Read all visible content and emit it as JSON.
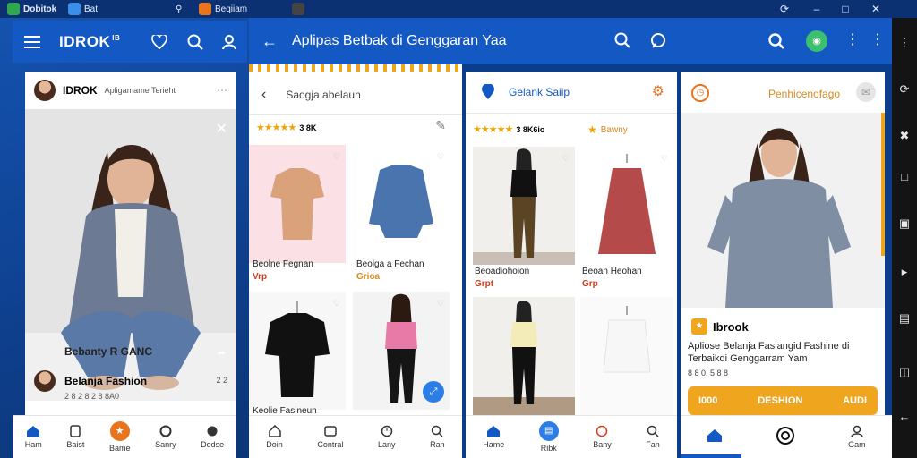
{
  "titlebar": {
    "tab1": "Dobitok",
    "tab2": "Bat",
    "tab3": "Beqiiam"
  },
  "app_brand": {
    "name": "IDROK",
    "sup": "IB"
  },
  "main_header": {
    "title": "Aplipas Betbak di Genggaran Yaa"
  },
  "panel1": {
    "user_name": "IDROK",
    "user_sub": "Apligamame Terieht",
    "caption": "Bebanty R GANC",
    "comment_name": "Belanja Fashion",
    "comment_meta": "2 8 2 8 2 8 8A0",
    "comment_time": "2 2"
  },
  "panel2": {
    "search": "Saogja abelaun",
    "rating_text": "3 8K",
    "cards": [
      {
        "title": "Beolne Fegnan",
        "price": "Vrp"
      },
      {
        "title": "Beolga a Fechan",
        "price": "Grioa"
      },
      {
        "title": "",
        "price": ""
      },
      {
        "title": "Keolie Fasineun",
        "price": ""
      }
    ]
  },
  "panel3": {
    "title": "Gelank Saiip",
    "rating_text": "3 8K6io",
    "badge": "Bawny",
    "cards": [
      {
        "title": "Beoadiohoion",
        "price": "Grpt"
      },
      {
        "title": "Beoan Heohan",
        "price": "Grp"
      }
    ]
  },
  "panel4": {
    "title": "Penhicenofago",
    "brand": "Ibrook",
    "headline": "Apliose Belanja Fasiangid Fashine di Terbaikdi Genggarram Yam",
    "meta": "8 8 0. 5 8 8",
    "cta_left": "I000",
    "cta_mid": "DESHION",
    "cta_right": "AUDI"
  },
  "bottom_nav": {
    "p1": [
      "Ham",
      "Baist",
      "Bame",
      "Sanry",
      "Dodse"
    ],
    "p2": [
      "Doin",
      "Contral",
      "Lany",
      "Ran"
    ],
    "p3": [
      "Hame",
      "Ribk",
      "Bany",
      "Fan"
    ],
    "p4": [
      "",
      "",
      "Gam"
    ]
  },
  "icons": {
    "menu": "hamburger-icon",
    "heart": "heart-icon",
    "search": "search-icon",
    "profile": "user-icon",
    "back": "back-arrow-icon",
    "chat": "chat-icon",
    "more": "kebab-icon"
  },
  "colors": {
    "primary_blue": "#1458c4",
    "accent_orange": "#f0a51e",
    "price_red": "#d13b1d"
  }
}
